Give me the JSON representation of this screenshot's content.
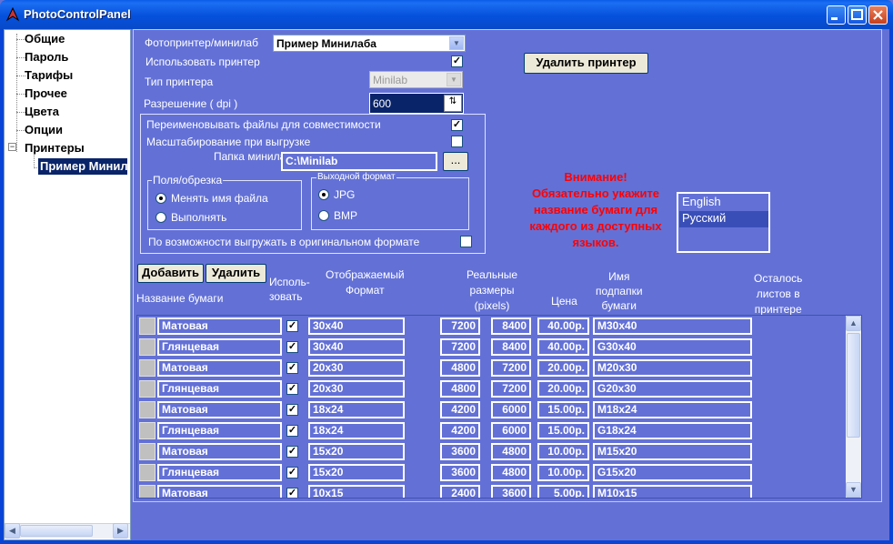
{
  "window": {
    "title": "PhotoControlPanel"
  },
  "tree": {
    "items": [
      "Общие",
      "Пароль",
      "Тарифы",
      "Прочее",
      "Цвета",
      "Опции",
      "Принтеры"
    ],
    "selected_child": "Пример Минилаба"
  },
  "printer": {
    "printer_label": "Фотопринтер/минилаб",
    "printer_value": "Пример Минилаба",
    "use_printer_label": "Использовать принтер",
    "use_printer_checked": true,
    "type_label": "Тип принтера",
    "type_value": "Minilab",
    "resolution_label": "Разрешение  ( dpi )",
    "resolution_value": "600",
    "delete_printer_button": "Удалить принтер",
    "rename_label": "Переименовывать файлы для совместимости",
    "rename_checked": true,
    "scale_label": "Масштабирование при выгрузке",
    "scale_checked": false,
    "folder_label": "Папка минилаба",
    "folder_value": "C:\\Minilab",
    "browse_button": "...",
    "margins_group": "Поля/обрезка",
    "radio_rename": "Менять имя файла",
    "radio_do": "Выполнять",
    "format_group": "Выходной формат",
    "radio_jpg": "JPG",
    "radio_bmp": "BMP",
    "original_label": "По возможности выгружать в оригинальном формате",
    "original_checked": false
  },
  "warning": {
    "line1": "Внимание!",
    "line2": "Обязательно укажите",
    "line3": "название бумаги для",
    "line4": "каждого из доступных",
    "line5": "языков."
  },
  "languages": [
    "English",
    "Русский"
  ],
  "paper": {
    "add_button": "Добавить",
    "delete_button": "Удалить",
    "col_name": "Название бумаги",
    "col_use": "Исполь-\nзовать",
    "col_format": "Отображаемый\nФормат",
    "col_sizes": "Реальные\nразмеры\n(pixels)",
    "col_price": "Цена",
    "col_subfolder": "Имя\nподпапки\nбумаги",
    "col_left": "Осталось\nлистов в\nпринтере",
    "rows": [
      {
        "name": "Матовая",
        "format": "30x40",
        "w": "7200",
        "h": "8400",
        "price": "40.00р.",
        "folder": "M30x40"
      },
      {
        "name": "Глянцевая",
        "format": "30x40",
        "w": "7200",
        "h": "8400",
        "price": "40.00р.",
        "folder": "G30x40"
      },
      {
        "name": "Матовая",
        "format": "20x30",
        "w": "4800",
        "h": "7200",
        "price": "20.00р.",
        "folder": "M20x30"
      },
      {
        "name": "Глянцевая",
        "format": "20x30",
        "w": "4800",
        "h": "7200",
        "price": "20.00р.",
        "folder": "G20x30"
      },
      {
        "name": "Матовая",
        "format": "18x24",
        "w": "4200",
        "h": "6000",
        "price": "15.00р.",
        "folder": "M18x24"
      },
      {
        "name": "Глянцевая",
        "format": "18x24",
        "w": "4200",
        "h": "6000",
        "price": "15.00р.",
        "folder": "G18x24"
      },
      {
        "name": "Матовая",
        "format": "15x20",
        "w": "3600",
        "h": "4800",
        "price": "10.00р.",
        "folder": "M15x20"
      },
      {
        "name": "Глянцевая",
        "format": "15x20",
        "w": "3600",
        "h": "4800",
        "price": "10.00р.",
        "folder": "G15x20"
      },
      {
        "name": "Матовая",
        "format": "10x15",
        "w": "2400",
        "h": "3600",
        "price": "5.00р.",
        "folder": "M10x15"
      }
    ]
  }
}
